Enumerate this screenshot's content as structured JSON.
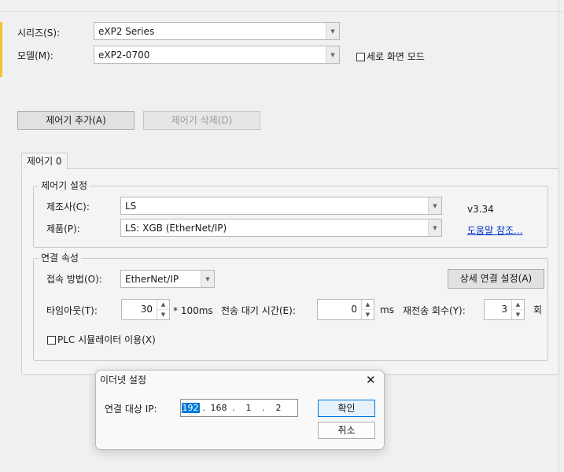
{
  "form": {
    "series_label": "시리즈(S):",
    "series_value": "eXP2 Series",
    "model_label": "모델(M):",
    "model_value": "eXP2-0700",
    "portrait_label": "세로 화면 모드",
    "add_controller": "제어기 추가(A)",
    "delete_controller": "제어기 삭제(D)"
  },
  "tab": {
    "label": "제어기 0"
  },
  "controller_settings": {
    "title": "제어기 설정",
    "maker_label": "제조사(C):",
    "maker_value": "LS",
    "product_label": "제품(P):",
    "product_value": "LS: XGB (EtherNet/IP)",
    "version": "v3.34",
    "help_link": "도움말 참조..."
  },
  "connection": {
    "title": "연결 속성",
    "method_label": "접속 방법(O):",
    "method_value": "EtherNet/IP",
    "detail_button": "상세 연결 설정(A)",
    "timeout_label": "타임아웃(T):",
    "timeout_value": "30",
    "timeout_unit": "* 100ms",
    "delay_label": "전송 대기 시간(E):",
    "delay_value": "0",
    "delay_unit": "ms",
    "retry_label": "재전송 회수(Y):",
    "retry_value": "3",
    "retry_unit": "회",
    "simulator_label": "PLC 시뮬레이터 이용(X)"
  },
  "dialog": {
    "title": "이더넷 설정",
    "close": "✕",
    "ip_label": "연결 대상 IP:",
    "ip": [
      "192",
      "168",
      "1",
      "2"
    ],
    "ip_sep": ".",
    "ok": "확인",
    "cancel": "취소"
  }
}
